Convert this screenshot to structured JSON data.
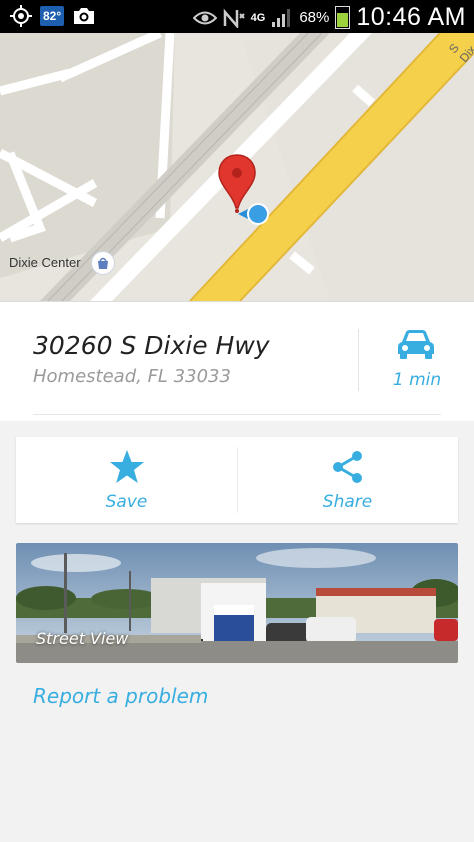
{
  "status_bar": {
    "temperature": "82°",
    "network": "4G",
    "battery_percent": "68%",
    "battery_level": 0.68,
    "time": "10:46 AM",
    "icons": [
      "gps-icon",
      "weather-icon",
      "camera-icon",
      "eye-icon",
      "no-signal-icon",
      "signal-icon",
      "battery-icon"
    ]
  },
  "map": {
    "place_label": "Dixie Center",
    "road_label": "S Dix"
  },
  "place": {
    "address": "30260 S Dixie Hwy",
    "city_state_zip": "Homestead, FL 33033"
  },
  "directions": {
    "icon": "car-icon",
    "travel_time": "1 min"
  },
  "actions": [
    {
      "label": "Save",
      "icon": "star-icon"
    },
    {
      "label": "Share",
      "icon": "share-icon"
    }
  ],
  "street_view": {
    "label": "Street View"
  },
  "report_link": "Report a problem",
  "colors": {
    "accent": "#38aee0",
    "route_yellow": "#f5d04a",
    "pin_red": "#e0362d"
  }
}
